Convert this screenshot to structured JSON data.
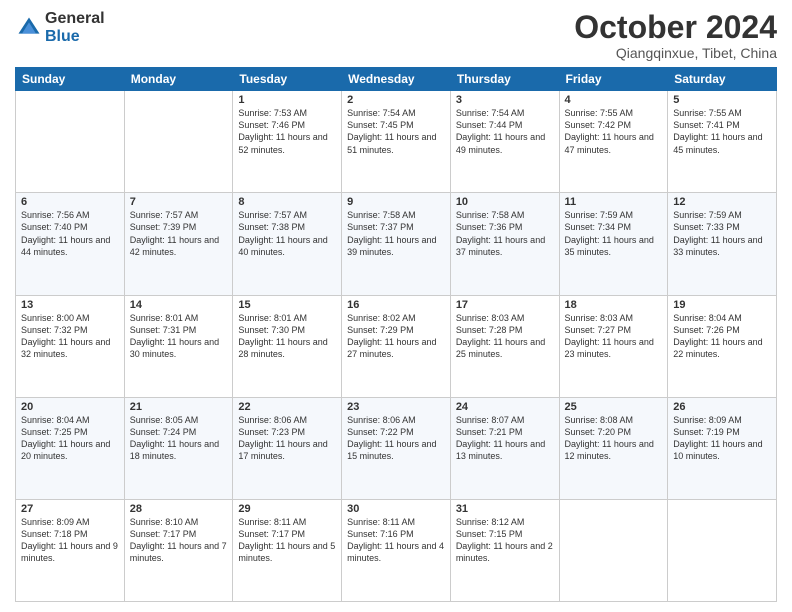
{
  "logo": {
    "general": "General",
    "blue": "Blue"
  },
  "header": {
    "month": "October 2024",
    "location": "Qiangqinxue, Tibet, China"
  },
  "weekdays": [
    "Sunday",
    "Monday",
    "Tuesday",
    "Wednesday",
    "Thursday",
    "Friday",
    "Saturday"
  ],
  "weeks": [
    [
      {
        "day": "",
        "content": ""
      },
      {
        "day": "",
        "content": ""
      },
      {
        "day": "1",
        "content": "Sunrise: 7:53 AM\nSunset: 7:46 PM\nDaylight: 11 hours and 52 minutes."
      },
      {
        "day": "2",
        "content": "Sunrise: 7:54 AM\nSunset: 7:45 PM\nDaylight: 11 hours and 51 minutes."
      },
      {
        "day": "3",
        "content": "Sunrise: 7:54 AM\nSunset: 7:44 PM\nDaylight: 11 hours and 49 minutes."
      },
      {
        "day": "4",
        "content": "Sunrise: 7:55 AM\nSunset: 7:42 PM\nDaylight: 11 hours and 47 minutes."
      },
      {
        "day": "5",
        "content": "Sunrise: 7:55 AM\nSunset: 7:41 PM\nDaylight: 11 hours and 45 minutes."
      }
    ],
    [
      {
        "day": "6",
        "content": "Sunrise: 7:56 AM\nSunset: 7:40 PM\nDaylight: 11 hours and 44 minutes."
      },
      {
        "day": "7",
        "content": "Sunrise: 7:57 AM\nSunset: 7:39 PM\nDaylight: 11 hours and 42 minutes."
      },
      {
        "day": "8",
        "content": "Sunrise: 7:57 AM\nSunset: 7:38 PM\nDaylight: 11 hours and 40 minutes."
      },
      {
        "day": "9",
        "content": "Sunrise: 7:58 AM\nSunset: 7:37 PM\nDaylight: 11 hours and 39 minutes."
      },
      {
        "day": "10",
        "content": "Sunrise: 7:58 AM\nSunset: 7:36 PM\nDaylight: 11 hours and 37 minutes."
      },
      {
        "day": "11",
        "content": "Sunrise: 7:59 AM\nSunset: 7:34 PM\nDaylight: 11 hours and 35 minutes."
      },
      {
        "day": "12",
        "content": "Sunrise: 7:59 AM\nSunset: 7:33 PM\nDaylight: 11 hours and 33 minutes."
      }
    ],
    [
      {
        "day": "13",
        "content": "Sunrise: 8:00 AM\nSunset: 7:32 PM\nDaylight: 11 hours and 32 minutes."
      },
      {
        "day": "14",
        "content": "Sunrise: 8:01 AM\nSunset: 7:31 PM\nDaylight: 11 hours and 30 minutes."
      },
      {
        "day": "15",
        "content": "Sunrise: 8:01 AM\nSunset: 7:30 PM\nDaylight: 11 hours and 28 minutes."
      },
      {
        "day": "16",
        "content": "Sunrise: 8:02 AM\nSunset: 7:29 PM\nDaylight: 11 hours and 27 minutes."
      },
      {
        "day": "17",
        "content": "Sunrise: 8:03 AM\nSunset: 7:28 PM\nDaylight: 11 hours and 25 minutes."
      },
      {
        "day": "18",
        "content": "Sunrise: 8:03 AM\nSunset: 7:27 PM\nDaylight: 11 hours and 23 minutes."
      },
      {
        "day": "19",
        "content": "Sunrise: 8:04 AM\nSunset: 7:26 PM\nDaylight: 11 hours and 22 minutes."
      }
    ],
    [
      {
        "day": "20",
        "content": "Sunrise: 8:04 AM\nSunset: 7:25 PM\nDaylight: 11 hours and 20 minutes."
      },
      {
        "day": "21",
        "content": "Sunrise: 8:05 AM\nSunset: 7:24 PM\nDaylight: 11 hours and 18 minutes."
      },
      {
        "day": "22",
        "content": "Sunrise: 8:06 AM\nSunset: 7:23 PM\nDaylight: 11 hours and 17 minutes."
      },
      {
        "day": "23",
        "content": "Sunrise: 8:06 AM\nSunset: 7:22 PM\nDaylight: 11 hours and 15 minutes."
      },
      {
        "day": "24",
        "content": "Sunrise: 8:07 AM\nSunset: 7:21 PM\nDaylight: 11 hours and 13 minutes."
      },
      {
        "day": "25",
        "content": "Sunrise: 8:08 AM\nSunset: 7:20 PM\nDaylight: 11 hours and 12 minutes."
      },
      {
        "day": "26",
        "content": "Sunrise: 8:09 AM\nSunset: 7:19 PM\nDaylight: 11 hours and 10 minutes."
      }
    ],
    [
      {
        "day": "27",
        "content": "Sunrise: 8:09 AM\nSunset: 7:18 PM\nDaylight: 11 hours and 9 minutes."
      },
      {
        "day": "28",
        "content": "Sunrise: 8:10 AM\nSunset: 7:17 PM\nDaylight: 11 hours and 7 minutes."
      },
      {
        "day": "29",
        "content": "Sunrise: 8:11 AM\nSunset: 7:17 PM\nDaylight: 11 hours and 5 minutes."
      },
      {
        "day": "30",
        "content": "Sunrise: 8:11 AM\nSunset: 7:16 PM\nDaylight: 11 hours and 4 minutes."
      },
      {
        "day": "31",
        "content": "Sunrise: 8:12 AM\nSunset: 7:15 PM\nDaylight: 11 hours and 2 minutes."
      },
      {
        "day": "",
        "content": ""
      },
      {
        "day": "",
        "content": ""
      }
    ]
  ]
}
